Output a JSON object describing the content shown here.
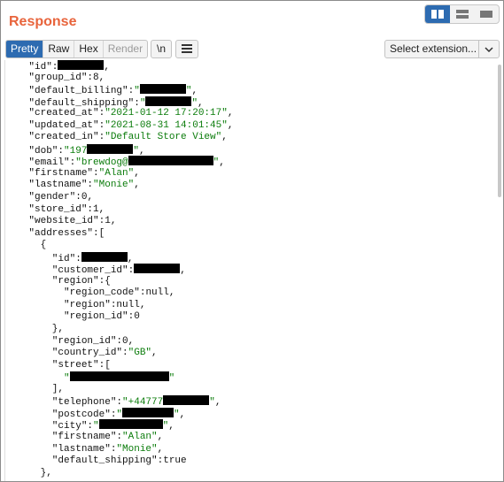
{
  "panel": {
    "title": "Response"
  },
  "view_toggle": {
    "options": [
      "split-columns",
      "split-rows",
      "single"
    ],
    "active": "split-columns"
  },
  "toolbar": {
    "tabs": [
      {
        "label": "Pretty",
        "state": "active"
      },
      {
        "label": "Raw",
        "state": "normal"
      },
      {
        "label": "Hex",
        "state": "normal"
      },
      {
        "label": "Render",
        "state": "disabled"
      }
    ],
    "newline_label": "\\n",
    "menu_icon": "hamburger-icon",
    "extension_select": "Select extension..."
  },
  "colors": {
    "title": "#e8643c",
    "active": "#2d6bb1",
    "string": "#0b7c0b"
  },
  "json_body": {
    "lines": [
      [
        {
          "t": "k",
          "v": "    \"id\":"
        },
        {
          "t": "r",
          "w": 52
        },
        {
          "t": "k",
          "v": ","
        }
      ],
      [
        {
          "t": "k",
          "v": "    \"group_id\":"
        },
        {
          "t": "n",
          "v": "8"
        },
        {
          "t": "k",
          "v": ","
        }
      ],
      [
        {
          "t": "k",
          "v": "    \"default_billing\":"
        },
        {
          "t": "s",
          "v": "\""
        },
        {
          "t": "r",
          "w": 52
        },
        {
          "t": "s",
          "v": "\""
        },
        {
          "t": "k",
          "v": ","
        }
      ],
      [
        {
          "t": "k",
          "v": "    \"default_shipping\":"
        },
        {
          "t": "s",
          "v": "\""
        },
        {
          "t": "r",
          "w": 52
        },
        {
          "t": "s",
          "v": "\""
        },
        {
          "t": "k",
          "v": ","
        }
      ],
      [
        {
          "t": "k",
          "v": "    \"created_at\":"
        },
        {
          "t": "s",
          "v": "\"2021-01-12 17:20:17\""
        },
        {
          "t": "k",
          "v": ","
        }
      ],
      [
        {
          "t": "k",
          "v": "    \"updated_at\":"
        },
        {
          "t": "s",
          "v": "\"2021-08-31 14:01:45\""
        },
        {
          "t": "k",
          "v": ","
        }
      ],
      [
        {
          "t": "k",
          "v": "    \"created_in\":"
        },
        {
          "t": "s",
          "v": "\"Default Store View\""
        },
        {
          "t": "k",
          "v": ","
        }
      ],
      [
        {
          "t": "k",
          "v": "    \"dob\":"
        },
        {
          "t": "s",
          "v": "\"197"
        },
        {
          "t": "r",
          "w": 52
        },
        {
          "t": "s",
          "v": "\""
        },
        {
          "t": "k",
          "v": ","
        }
      ],
      [
        {
          "t": "k",
          "v": "    \"email\":"
        },
        {
          "t": "s",
          "v": "\"brewdog@"
        },
        {
          "t": "r",
          "w": 96
        },
        {
          "t": "s",
          "v": "\""
        },
        {
          "t": "k",
          "v": ","
        }
      ],
      [
        {
          "t": "k",
          "v": "    \"firstname\":"
        },
        {
          "t": "s",
          "v": "\"Alan\""
        },
        {
          "t": "k",
          "v": ","
        }
      ],
      [
        {
          "t": "k",
          "v": "    \"lastname\":"
        },
        {
          "t": "s",
          "v": "\"Monie\""
        },
        {
          "t": "k",
          "v": ","
        }
      ],
      [
        {
          "t": "k",
          "v": "    \"gender\":"
        },
        {
          "t": "n",
          "v": "0"
        },
        {
          "t": "k",
          "v": ","
        }
      ],
      [
        {
          "t": "k",
          "v": "    \"store_id\":"
        },
        {
          "t": "n",
          "v": "1"
        },
        {
          "t": "k",
          "v": ","
        }
      ],
      [
        {
          "t": "k",
          "v": "    \"website_id\":"
        },
        {
          "t": "n",
          "v": "1"
        },
        {
          "t": "k",
          "v": ","
        }
      ],
      [
        {
          "t": "k",
          "v": "    \"addresses\":["
        }
      ],
      [
        {
          "t": "k",
          "v": "      {"
        }
      ],
      [
        {
          "t": "k",
          "v": "        \"id\":"
        },
        {
          "t": "r",
          "w": 52
        },
        {
          "t": "k",
          "v": ","
        }
      ],
      [
        {
          "t": "k",
          "v": "        \"customer_id\":"
        },
        {
          "t": "r",
          "w": 52
        },
        {
          "t": "k",
          "v": ","
        }
      ],
      [
        {
          "t": "k",
          "v": "        \"region\":{"
        }
      ],
      [
        {
          "t": "k",
          "v": "          \"region_code\":"
        },
        {
          "t": "n",
          "v": "null"
        },
        {
          "t": "k",
          "v": ","
        }
      ],
      [
        {
          "t": "k",
          "v": "          \"region\":"
        },
        {
          "t": "n",
          "v": "null"
        },
        {
          "t": "k",
          "v": ","
        }
      ],
      [
        {
          "t": "k",
          "v": "          \"region_id\":"
        },
        {
          "t": "n",
          "v": "0"
        }
      ],
      [
        {
          "t": "k",
          "v": "        },"
        }
      ],
      [
        {
          "t": "k",
          "v": "        \"region_id\":"
        },
        {
          "t": "n",
          "v": "0"
        },
        {
          "t": "k",
          "v": ","
        }
      ],
      [
        {
          "t": "k",
          "v": "        \"country_id\":"
        },
        {
          "t": "s",
          "v": "\"GB\""
        },
        {
          "t": "k",
          "v": ","
        }
      ],
      [
        {
          "t": "k",
          "v": "        \"street\":["
        }
      ],
      [
        {
          "t": "k",
          "v": "          "
        },
        {
          "t": "s",
          "v": "\""
        },
        {
          "t": "r",
          "w": 112
        },
        {
          "t": "s",
          "v": "\""
        }
      ],
      [
        {
          "t": "k",
          "v": "        ],"
        }
      ],
      [
        {
          "t": "k",
          "v": "        \"telephone\":"
        },
        {
          "t": "s",
          "v": "\"+44777"
        },
        {
          "t": "r",
          "w": 52
        },
        {
          "t": "s",
          "v": "\""
        },
        {
          "t": "k",
          "v": ","
        }
      ],
      [
        {
          "t": "k",
          "v": "        \"postcode\":"
        },
        {
          "t": "s",
          "v": "\""
        },
        {
          "t": "r",
          "w": 58
        },
        {
          "t": "s",
          "v": "\""
        },
        {
          "t": "k",
          "v": ","
        }
      ],
      [
        {
          "t": "k",
          "v": "        \"city\":"
        },
        {
          "t": "s",
          "v": "\""
        },
        {
          "t": "r",
          "w": 72
        },
        {
          "t": "s",
          "v": "\""
        },
        {
          "t": "k",
          "v": ","
        }
      ],
      [
        {
          "t": "k",
          "v": "        \"firstname\":"
        },
        {
          "t": "s",
          "v": "\"Alan\""
        },
        {
          "t": "k",
          "v": ","
        }
      ],
      [
        {
          "t": "k",
          "v": "        \"lastname\":"
        },
        {
          "t": "s",
          "v": "\"Monie\""
        },
        {
          "t": "k",
          "v": ","
        }
      ],
      [
        {
          "t": "k",
          "v": "        \"default_shipping\":"
        },
        {
          "t": "n",
          "v": "true"
        }
      ],
      [
        {
          "t": "k",
          "v": "      },"
        }
      ]
    ]
  }
}
